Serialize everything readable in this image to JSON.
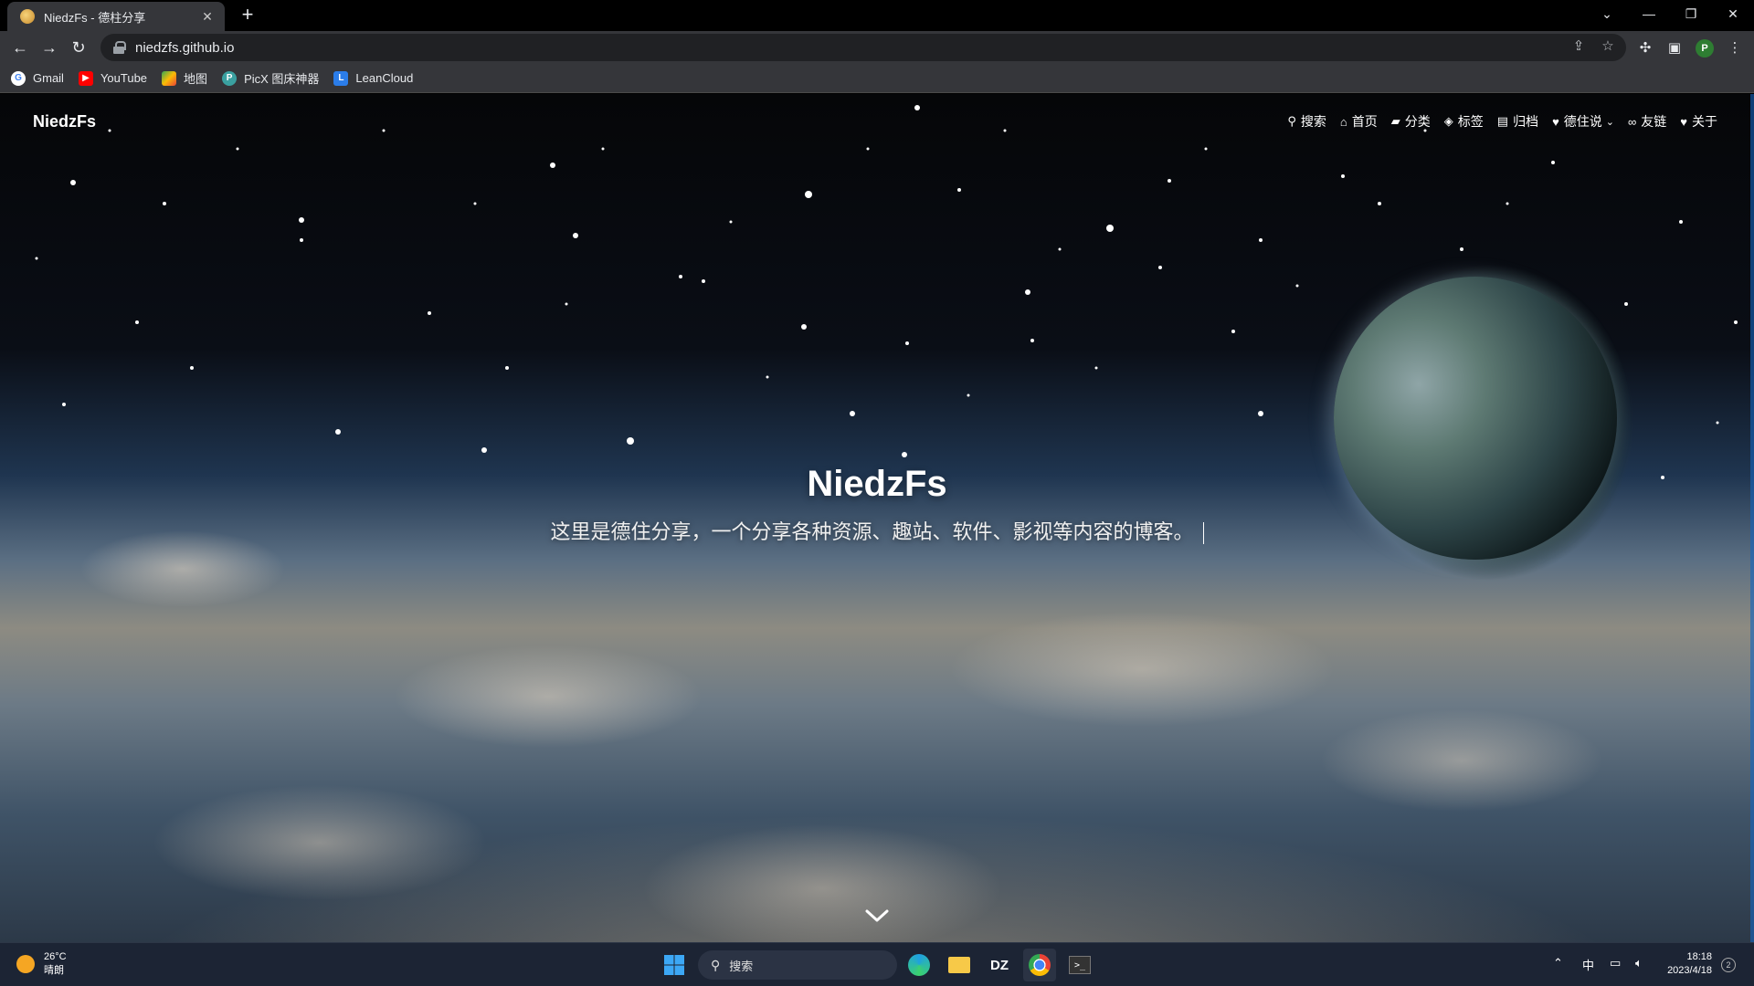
{
  "browser": {
    "tab_title": "NiedzFs - 德柱分享",
    "new_tab": "+",
    "url": "niedzfs.github.io",
    "icons": {
      "back": "back-arrow-icon",
      "forward": "forward-arrow-icon",
      "reload": "reload-icon",
      "share": "share-icon",
      "star": "bookmark-star-icon",
      "extensions": "puzzle-icon",
      "sidepanel": "side-panel-icon",
      "menu": "kebab-menu-icon"
    },
    "profile_initial": "P",
    "bookmarks": [
      {
        "label": "Gmail",
        "icon": "google-icon",
        "color": "#4285f4"
      },
      {
        "label": "YouTube",
        "icon": "youtube-icon",
        "color": "#ff0000"
      },
      {
        "label": "地图",
        "icon": "maps-icon",
        "color": "#34a853"
      },
      {
        "label": "PicX 图床神器",
        "icon": "picx-icon",
        "color": "#3aa0a0"
      },
      {
        "label": "LeanCloud",
        "icon": "leancloud-icon",
        "color": "#2b7de9"
      }
    ]
  },
  "site": {
    "brand": "NiedzFs",
    "nav": [
      {
        "label": "搜索",
        "icon": "search-icon"
      },
      {
        "label": "首页",
        "icon": "home-icon"
      },
      {
        "label": "分类",
        "icon": "folder-icon"
      },
      {
        "label": "标签",
        "icon": "tags-icon"
      },
      {
        "label": "归档",
        "icon": "archive-icon"
      },
      {
        "label": "德住说",
        "icon": "heart-icon",
        "has_dropdown": true
      },
      {
        "label": "友链",
        "icon": "link-icon"
      },
      {
        "label": "关于",
        "icon": "heart-icon"
      }
    ],
    "hero": {
      "title": "NiedzFs",
      "subtitle": "这里是德住分享，一个分享各种资源、趣站、软件、影视等内容的博客。"
    }
  },
  "taskbar": {
    "weather_temp": "26°C",
    "weather_desc": "晴朗",
    "search_placeholder": "搜索",
    "ime": "中",
    "time": "18:18",
    "date": "2023/4/18",
    "notification_count": "2"
  },
  "colors": {
    "chrome_dark": "#35363a",
    "tabstrip": "#000000",
    "taskbar": "#1c2434",
    "accent": "#1565c0"
  }
}
